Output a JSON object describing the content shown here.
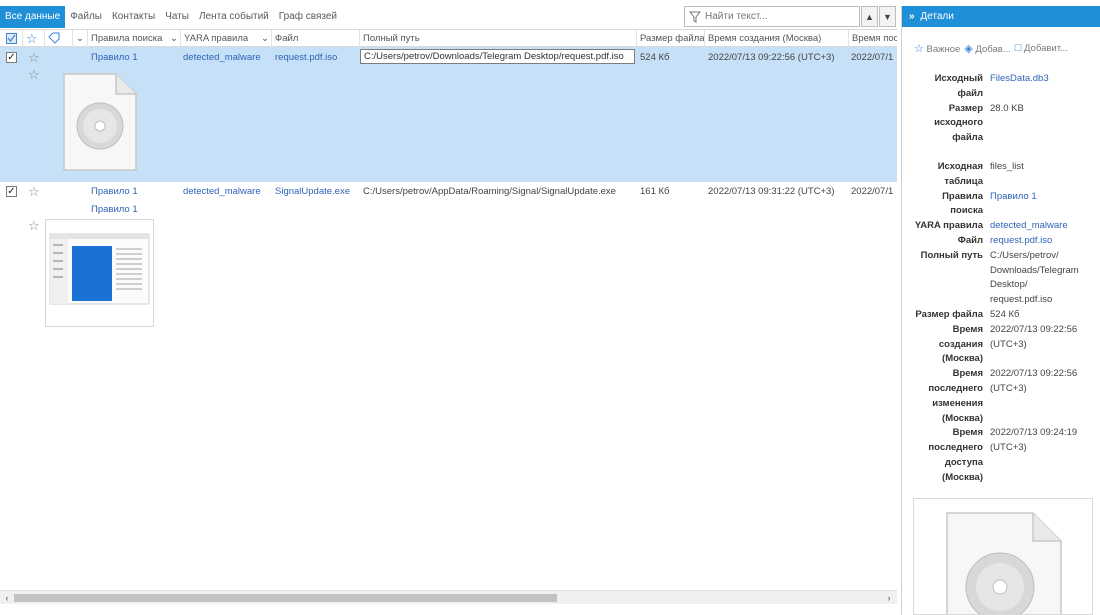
{
  "tabs": [
    "Все данные",
    "Файлы",
    "Контакты",
    "Чаты",
    "Лента событий",
    "Граф связей"
  ],
  "search": {
    "placeholder": "Найти текст..."
  },
  "columns": {
    "rule": "Правила поиска",
    "yara": "YARA правила",
    "file": "Файл",
    "path": "Полный путь",
    "size": "Размер файла",
    "created": "Время создания (Москва)",
    "modified": "Время пос"
  },
  "rows": [
    {
      "rule": "Правило 1",
      "yara": "detected_malware",
      "file": "request.pdf.iso",
      "path": "C:/Users/petrov/Downloads/Telegram Desktop/request.pdf.iso",
      "size": "524 Кб",
      "created": "2022/07/13 09:22:56 (UTC+3)",
      "modified": "2022/07/1"
    },
    {
      "rule": "Правило 1",
      "rule2": "Правило 1",
      "yara": "detected_malware",
      "file": "SignalUpdate.exe",
      "path": "C:/Users/petrov/AppData/Roaming/Signal/SignalUpdate.exe",
      "size": "161 Кб",
      "created": "2022/07/13 09:31:22 (UTC+3)",
      "modified": "2022/07/1"
    }
  ],
  "details": {
    "title": "Детали",
    "actions": [
      "Важное",
      "Добав...",
      "Добавит..."
    ],
    "fields": [
      {
        "key": [
          "Исходный",
          "файл"
        ],
        "value": [
          "FilesData.db3"
        ],
        "link": true
      },
      {
        "key": [
          "Размер",
          "исходного",
          "файла"
        ],
        "value": [
          "28.0 KB"
        ],
        "link": false
      },
      {
        "key": [
          "Исходная",
          "таблица"
        ],
        "value": [
          "files_list"
        ],
        "link": false
      },
      {
        "key": [
          "Правила",
          "поиска"
        ],
        "value": [
          "Правило 1"
        ],
        "link": true
      },
      {
        "key": [
          "YARA правила"
        ],
        "value": [
          "detected_malware"
        ],
        "link": true
      },
      {
        "key": [
          "Файл"
        ],
        "value": [
          "request.pdf.iso"
        ],
        "link": true
      },
      {
        "key": [
          "Полный путь"
        ],
        "value": [
          "C:/Users/petrov/",
          "Downloads/Telegram",
          "Desktop/",
          "request.pdf.iso"
        ],
        "link": false
      },
      {
        "key": [
          "Размер файла"
        ],
        "value": [
          "524 Кб"
        ],
        "link": false
      },
      {
        "key": [
          "Время",
          "создания",
          "(Москва)"
        ],
        "value": [
          "2022/07/13 09:22:56",
          "(UTC+3)"
        ],
        "link": false
      },
      {
        "key": [
          "Время",
          "последнего",
          "изменения",
          "(Москва)"
        ],
        "value": [
          "2022/07/13 09:22:56",
          "(UTC+3)"
        ],
        "link": false
      },
      {
        "key": [
          "Время",
          "последнего",
          "доступа",
          "(Москва)"
        ],
        "value": [
          "2022/07/13 09:24:19",
          "(UTC+3)"
        ],
        "link": false
      }
    ]
  },
  "colors": {
    "accent": "#1f8fd8",
    "selection": "#c6e1f7",
    "link": "#2f63b8"
  },
  "icons": [
    "filter-icon",
    "star-icon",
    "tag-icon",
    "checkbox-icon",
    "chevron-up-icon",
    "chevron-down-icon",
    "double-chevron-right-icon",
    "disc-file-icon",
    "app-window-thumbnail"
  ]
}
